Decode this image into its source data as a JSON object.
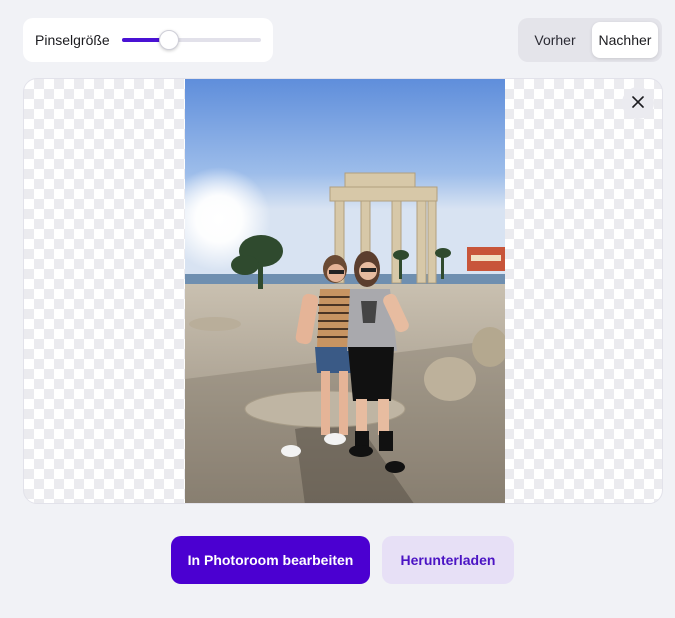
{
  "brush": {
    "label": "Pinselgröße",
    "value_fraction": 0.34
  },
  "view_toggle": {
    "before_label": "Vorher",
    "after_label": "Nachher",
    "selected": "after"
  },
  "preview": {
    "close_icon": "close-icon",
    "image_alt": "Zwei Frauen vor antiken Tempelsäulen"
  },
  "actions": {
    "edit_label": "In Photoroom bearbeiten",
    "download_label": "Herunterladen"
  },
  "colors": {
    "accent": "#4b00d1",
    "secondary_bg": "#e7e0f6",
    "page_bg": "#f1f2f6"
  }
}
